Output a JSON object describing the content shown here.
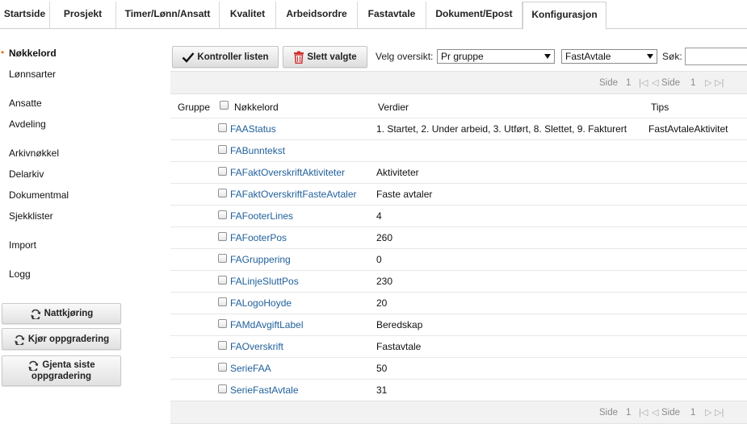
{
  "tabs": [
    {
      "label": "Startside"
    },
    {
      "label": "Prosjekt"
    },
    {
      "label": "Timer/Lønn/Ansatt"
    },
    {
      "label": "Kvalitet"
    },
    {
      "label": "Arbeidsordre"
    },
    {
      "label": "Fastavtale"
    },
    {
      "label": "Dokument/Epost"
    },
    {
      "label": "Konfigurasjon"
    }
  ],
  "sidebar": {
    "items": [
      {
        "label": "Nøkkelord"
      },
      {
        "label": "Lønnsarter"
      },
      {
        "label": "Ansatte"
      },
      {
        "label": "Avdeling"
      },
      {
        "label": "Arkivnøkkel"
      },
      {
        "label": "Delarkiv"
      },
      {
        "label": "Dokumentmal"
      },
      {
        "label": "Sjekklister"
      },
      {
        "label": "Import"
      },
      {
        "label": "Logg"
      }
    ],
    "buttons": [
      {
        "label": "Nattkjøring"
      },
      {
        "label": "Kjør oppgradering"
      },
      {
        "label_line1": "Gjenta siste",
        "label_line2": "oppgradering"
      }
    ]
  },
  "toolbar": {
    "check_label": "Kontroller listen",
    "delete_label": "Slett valgte",
    "overview_label": "Velg oversikt:",
    "overview_value": "Pr gruppe",
    "type_value": "FastAvtale",
    "search_label": "Søk:",
    "search_value": ""
  },
  "pager": {
    "page_label": "Side",
    "page_value": "1",
    "page_label2": "Side",
    "page_value2": "1"
  },
  "table": {
    "headers": {
      "group": "Gruppe",
      "key": "Nøkkelord",
      "values": "Verdier",
      "tips": "Tips"
    },
    "rows": [
      {
        "key": "FAAStatus",
        "value": "1. Startet, 2. Under arbeid, 3. Utført, 8. Slettet, 9. Fakturert",
        "tip": "FastAvtaleAktivitet"
      },
      {
        "key": "FABunntekst",
        "value": "",
        "tip": ""
      },
      {
        "key": "FAFaktOverskriftAktiviteter",
        "value": "Aktiviteter",
        "tip": ""
      },
      {
        "key": "FAFaktOverskriftFasteAvtaler",
        "value": "Faste avtaler",
        "tip": ""
      },
      {
        "key": "FAFooterLines",
        "value": "4",
        "tip": ""
      },
      {
        "key": "FAFooterPos",
        "value": "260",
        "tip": ""
      },
      {
        "key": "FAGruppering",
        "value": "0",
        "tip": ""
      },
      {
        "key": "FALinjeSluttPos",
        "value": "230",
        "tip": ""
      },
      {
        "key": "FALogoHoyde",
        "value": "20",
        "tip": ""
      },
      {
        "key": "FAMdAvgiftLabel",
        "value": "Beredskap",
        "tip": ""
      },
      {
        "key": "FAOverskrift",
        "value": "Fastavtale",
        "tip": ""
      },
      {
        "key": "SerieFAA",
        "value": "50",
        "tip": ""
      },
      {
        "key": "SerieFastAvtale",
        "value": "31",
        "tip": ""
      }
    ]
  },
  "colors": {
    "accent": "#e8731a",
    "link": "#1f5f9a",
    "delete_icon": "#d32f2f"
  }
}
